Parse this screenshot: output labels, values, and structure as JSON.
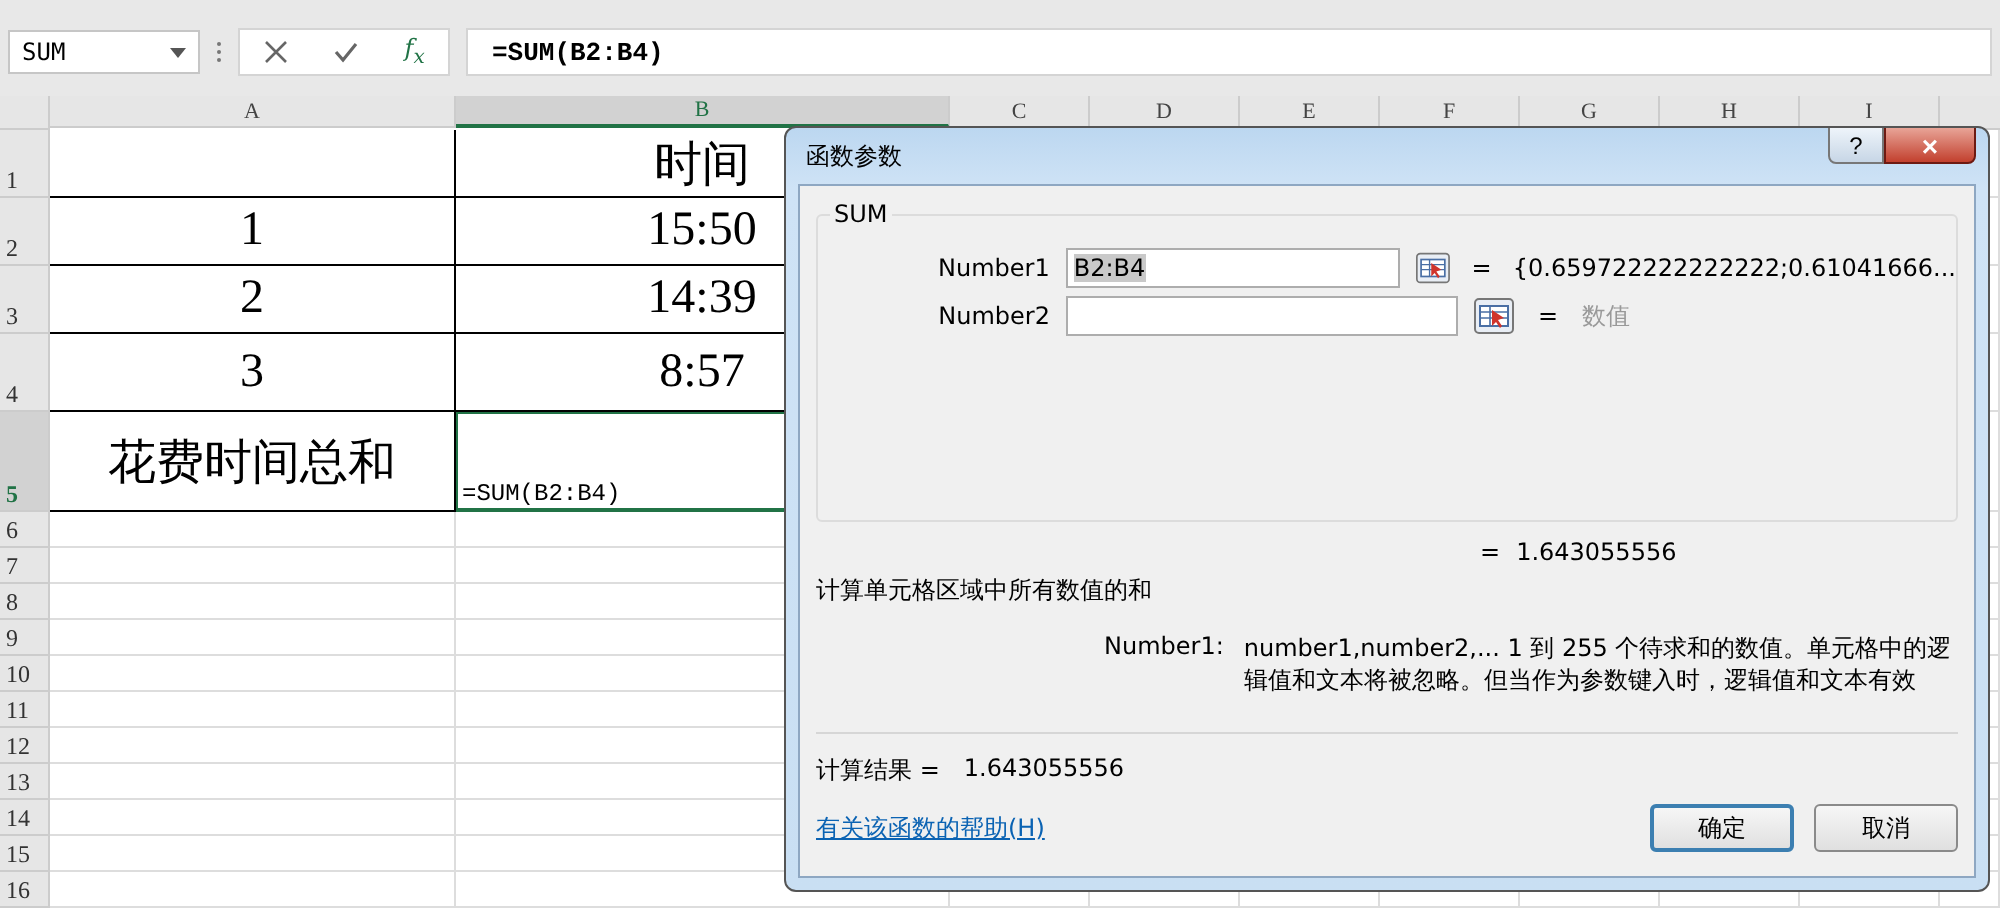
{
  "name_box": {
    "value": "SUM"
  },
  "formula_bar": {
    "function_label": "f$_{x}$",
    "formula": "=SUM(B2:B4)"
  },
  "columns": [
    {
      "label": "A",
      "selected": false
    },
    {
      "label": "B",
      "selected": true
    },
    {
      "label": "C",
      "selected": false
    },
    {
      "label": "D",
      "selected": false
    },
    {
      "label": "E",
      "selected": false
    },
    {
      "label": "F",
      "selected": false
    },
    {
      "label": "G",
      "selected": false
    },
    {
      "label": "H",
      "selected": false
    },
    {
      "label": "I",
      "selected": false
    }
  ],
  "rows": [
    {
      "label": "1",
      "selected": false,
      "b": "时间"
    },
    {
      "label": "2",
      "selected": false,
      "a": "1",
      "b": "15:50"
    },
    {
      "label": "3",
      "selected": false,
      "a": "2",
      "b": "14:39"
    },
    {
      "label": "4",
      "selected": false,
      "a": "3",
      "b": "8:57"
    },
    {
      "label": "5",
      "selected": true,
      "a": "花费时间总和",
      "b": "=SUM(B2:B4)"
    },
    {
      "label": "6",
      "selected": false
    },
    {
      "label": "7",
      "selected": false
    },
    {
      "label": "8",
      "selected": false
    },
    {
      "label": "9",
      "selected": false
    },
    {
      "label": "10",
      "selected": false
    },
    {
      "label": "11",
      "selected": false
    },
    {
      "label": "12",
      "selected": false
    },
    {
      "label": "13",
      "selected": false
    },
    {
      "label": "14",
      "selected": false
    },
    {
      "label": "15",
      "selected": false
    },
    {
      "label": "16",
      "selected": false
    }
  ],
  "dialog": {
    "title": "函数参数",
    "help_button": "?",
    "close_button": "×",
    "function_name": "SUM",
    "args": [
      {
        "label": "Number1",
        "value": "B2:B4",
        "highlighted": true,
        "equals": "=",
        "result": "{0.659722222222222;0.61041666...",
        "dimmed": false
      },
      {
        "label": "Number2",
        "equals": "=",
        "result": "数值",
        "dimmed": true
      }
    ],
    "total": {
      "equals": "=",
      "value": "1.643055556"
    },
    "description": "计算单元格区域中所有数值的和",
    "arg_help": {
      "label": "Number1:",
      "text": "number1,number2,...  1 到 255 个待求和的数值。单元格中的逻辑值和文本将被忽略。但当作为参数键入时，逻辑值和文本有效"
    },
    "calc_result": {
      "label": "计算结果 =",
      "value": "1.643055556"
    },
    "help_link": "有关该函数的帮助(H)",
    "buttons": [
      {
        "label": "确定",
        "default": true
      },
      {
        "label": "取消",
        "default": false
      }
    ]
  }
}
